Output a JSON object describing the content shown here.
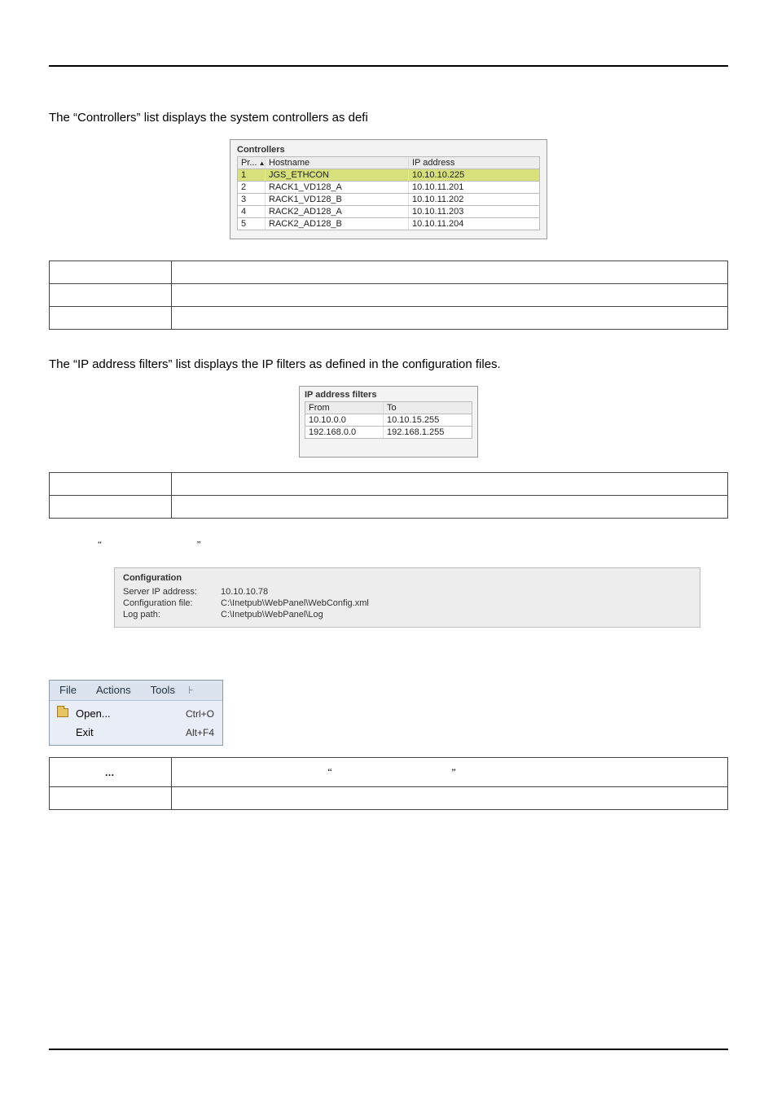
{
  "paragraphs": {
    "p1": "The “Controllers” list displays the system controllers as defi",
    "p2": "The “IP address filters” list displays the IP filters as defined in the configuration files."
  },
  "controllers": {
    "title": "Controllers",
    "headers": {
      "pr": "Pr...",
      "hostname": "Hostname",
      "ip": "IP address"
    },
    "rows": [
      {
        "pr": "1",
        "hostname": "JGS_ETHCON",
        "ip": "10.10.10.225",
        "highlight": true
      },
      {
        "pr": "2",
        "hostname": "RACK1_VD128_A",
        "ip": "10.10.11.201",
        "highlight": false
      },
      {
        "pr": "3",
        "hostname": "RACK1_VD128_B",
        "ip": "10.10.11.202",
        "highlight": false
      },
      {
        "pr": "4",
        "hostname": "RACK2_AD128_A",
        "ip": "10.10.11.203",
        "highlight": false
      },
      {
        "pr": "5",
        "hostname": "RACK2_AD128_B",
        "ip": "10.10.11.204",
        "highlight": false
      }
    ]
  },
  "filters": {
    "title": "IP address filters",
    "headers": {
      "from": "From",
      "to": "To"
    },
    "rows": [
      {
        "from": "10.10.0.0",
        "to": "10.10.15.255"
      },
      {
        "from": "192.168.0.0",
        "to": "192.168.1.255"
      }
    ]
  },
  "configuration": {
    "title": "Configuration",
    "server_ip_label": "Server IP address:",
    "server_ip_value": "10.10.10.78",
    "config_file_label": "Configuration file:",
    "config_file_value": "C:\\Inetpub\\WebPanel\\WebConfig.xml",
    "log_path_label": "Log path:",
    "log_path_value": "C:\\Inetpub\\WebPanel\\Log"
  },
  "menu": {
    "file": "File",
    "actions": "Actions",
    "tools": "Tools",
    "open_label": "Open...",
    "open_shortcut": "Ctrl+O",
    "exit_label": "Exit",
    "exit_shortcut": "Alt+F4"
  },
  "file_desc": {
    "dots": "…",
    "lq": "“",
    "rq": "”"
  },
  "inline_quotes": {
    "lq": "“",
    "rq": "”"
  }
}
